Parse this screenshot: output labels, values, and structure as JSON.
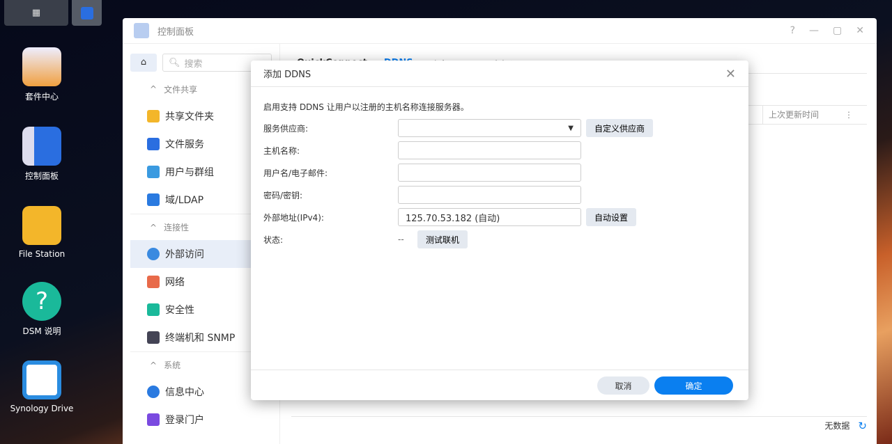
{
  "taskbar": {
    "main_menu": "main-menu",
    "control_panel": "control-panel"
  },
  "desktop": [
    {
      "label": "套件中心",
      "color": "#f0c040"
    },
    {
      "label": "控制面板",
      "color": "#2a6ee0"
    },
    {
      "label": "File Station",
      "color": "#f3b62a"
    },
    {
      "label": "DSM 说明",
      "color": "#1ab99a"
    },
    {
      "label": "Synology Drive",
      "color": "#2a8ce0"
    }
  ],
  "window": {
    "title": "控制面板",
    "controls": [
      "?",
      "—",
      "▢",
      "✕"
    ]
  },
  "sidebar": {
    "search_placeholder": "搜索",
    "sections": [
      {
        "title": "文件共享",
        "items": [
          "共享文件夹",
          "文件服务",
          "用户与群组",
          "域/LDAP"
        ]
      },
      {
        "title": "连接性",
        "items": [
          "外部访问",
          "网络",
          "安全性",
          "终端机和 SNMP"
        ]
      },
      {
        "title": "系统",
        "items": [
          "信息中心",
          "登录门户"
        ]
      }
    ]
  },
  "main": {
    "tabs": [
      "QuickConnect",
      "DDNS",
      "路由器配置",
      "高级设置"
    ],
    "column_last_update": "上次更新时间",
    "no_data": "无数据"
  },
  "dialog": {
    "title": "添加 DDNS",
    "close": "✕",
    "description": "启用支持 DDNS 让用户以注册的主机名称连接服务器。",
    "fields": {
      "provider": "服务供应商:",
      "hostname": "主机名称:",
      "username": "用户名/电子邮件:",
      "password": "密码/密钥:",
      "external": "外部地址(IPv4):",
      "status": "状态:"
    },
    "external_value": "125.70.53.182 (自动)",
    "status_value": "--",
    "buttons": {
      "custom_provider": "自定义供应商",
      "auto_setup": "自动设置",
      "test": "测试联机",
      "cancel": "取消",
      "ok": "确定"
    }
  },
  "colors": {
    "accent": "#0a7ff0"
  }
}
